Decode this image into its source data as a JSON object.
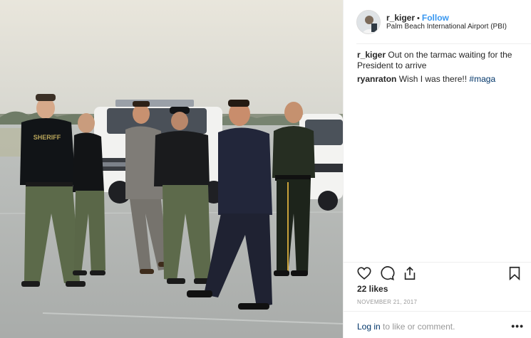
{
  "post": {
    "username": "r_kiger",
    "separator": "•",
    "follow_label": "Follow",
    "location": "Palm Beach International Airport (PBI)"
  },
  "comments": [
    {
      "user": "r_kiger",
      "text": "Out on the tarmac waiting for the President to arrive",
      "hashtag": ""
    },
    {
      "user": "ryanraton",
      "text": "Wish I was there!!",
      "hashtag": "#maga"
    }
  ],
  "photo": {
    "vest_text": "SHERIFF"
  },
  "actions": {
    "like_icon": "heart-icon",
    "comment_icon": "comment-icon",
    "share_icon": "share-icon",
    "save_icon": "bookmark-icon"
  },
  "likes": "22 likes",
  "date": "NOVEMBER 21, 2017",
  "footer": {
    "login_label": "Log in",
    "login_suffix": " to like or comment.",
    "more_label": "•••"
  },
  "colors": {
    "link": "#3897f0",
    "hashtag": "#003569",
    "muted": "#999999"
  }
}
